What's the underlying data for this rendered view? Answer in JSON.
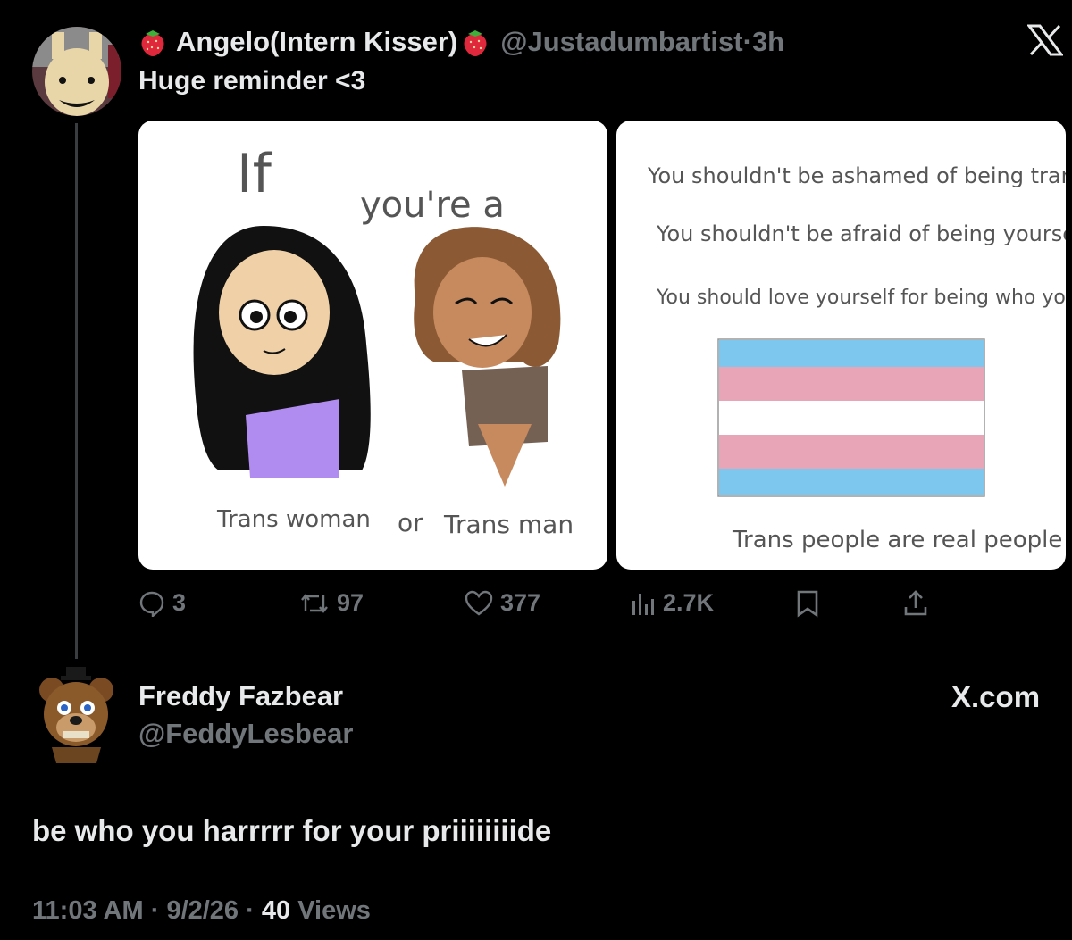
{
  "tweet": {
    "author_name": "Angelo(Intern Kisser)",
    "author_handle": "@Justadumbartist",
    "time_sep": " · ",
    "time": "3h",
    "text": "Huge reminder <3",
    "images": [
      {
        "alt_texts": [
          "If",
          "you're a",
          "Trans woman",
          "or",
          "Trans man"
        ]
      },
      {
        "lines": [
          "You shouldn't be ashamed of being trans.",
          "You shouldn't be afraid of being yourself.",
          "You should love yourself for being who you are."
        ],
        "caption": "Trans people are real people",
        "flag_colors": [
          "#7dc6ee",
          "#e8a5b8",
          "#ffffff",
          "#e8a5b8",
          "#7dc6ee"
        ]
      }
    ],
    "actions": {
      "replies": "3",
      "reposts": "97",
      "likes": "377",
      "views": "2.7K"
    }
  },
  "reply": {
    "author_name": "Freddy Fazbear",
    "author_handle": "@FeddyLesbear",
    "text": "be who you harrrrr for your priiiiiiiide",
    "time": "11:03 AM",
    "date": "9/2/26",
    "views_count": "40",
    "views_label": "Views",
    "sep": " · "
  },
  "brand": {
    "watermark": "X.com"
  },
  "colors": {
    "background": "#000000",
    "text": "#e7e9ea",
    "muted": "#71767b"
  }
}
